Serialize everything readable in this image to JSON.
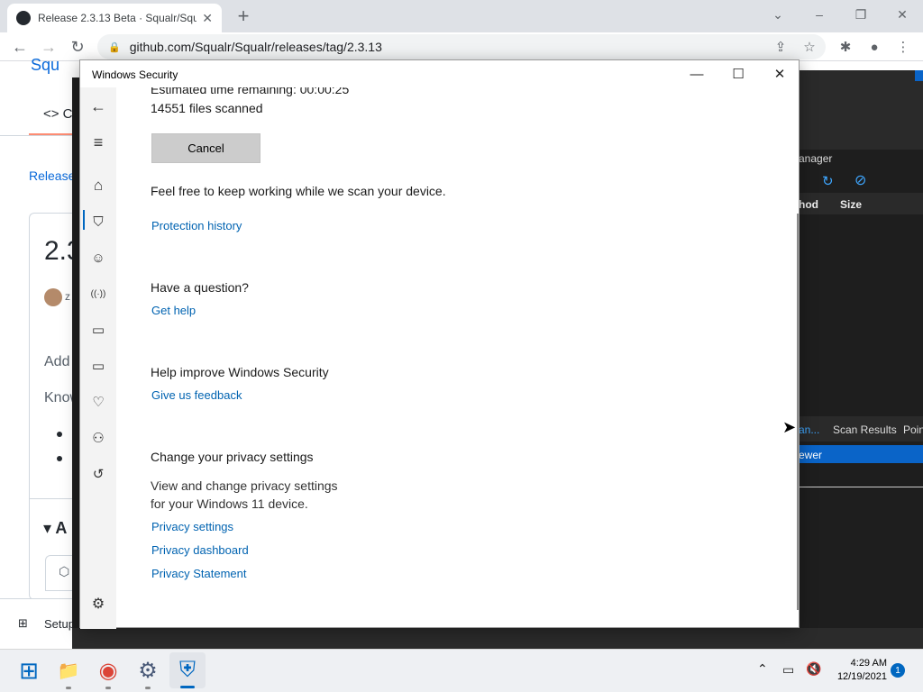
{
  "browser": {
    "tab_title": "Release 2.3.13 Beta · Squalr/Squa",
    "tab_close": "✕",
    "new_tab": "+",
    "url": "github.com/Squalr/Squalr/releases/tag/2.3.13",
    "window_controls": {
      "collapse": "⌄",
      "minimize": "–",
      "restore": "❐",
      "close": "✕"
    },
    "nav": {
      "back": "←",
      "forward": "→",
      "reload": "↻"
    },
    "toolbar_icons": {
      "share": "⇪",
      "star": "☆",
      "extensions": "✱",
      "profile": "●",
      "menu": "⋮"
    }
  },
  "github_bg": {
    "repo": "Squ",
    "code_tab": "<> C",
    "releases_link": "Release",
    "version": "2.3",
    "author": "z",
    "add": "Add",
    "know": "Know",
    "assets": "▾ A",
    "setup": "Setup"
  },
  "darkapp": {
    "manager": "anager",
    "method": "hod",
    "size": "Size",
    "scan_tab": "an...",
    "scan_results": "Scan Results",
    "pointer": "Poin",
    "viewer": "ewer"
  },
  "ws": {
    "title": "Windows Security",
    "controls": {
      "minimize": "—",
      "maximize": "☐",
      "close": "✕"
    },
    "nav_icons": {
      "back": "←",
      "menu": "≡",
      "home": "⌂",
      "shield": "⛉",
      "account": "☺",
      "network": "((·))",
      "app": "▭",
      "device": "▭",
      "health": "♡",
      "family": "⚇",
      "history": "↺",
      "settings": "⚙"
    },
    "estimated_time": "Estimated time remaining: 00:00:25",
    "files_scanned": "14551 files scanned",
    "cancel": "Cancel",
    "keep_working": "Feel free to keep working while we scan your device.",
    "protection_history": "Protection history",
    "question_heading": "Have a question?",
    "get_help": "Get help",
    "improve_heading": "Help improve Windows Security",
    "feedback": "Give us feedback",
    "privacy_heading": "Change your privacy settings",
    "privacy_desc_1": "View and change privacy settings",
    "privacy_desc_2": "for your Windows 11 device.",
    "privacy_settings": "Privacy settings",
    "privacy_dashboard": "Privacy dashboard",
    "privacy_statement": "Privacy Statement"
  },
  "taskbar": {
    "time": "4:29 AM",
    "date": "12/19/2021",
    "notifications": "1",
    "tray_chevron": "⌃",
    "icons": {
      "start": "⊞",
      "explorer": "📁",
      "chrome": "◉",
      "settings": "⚙",
      "defender": "⛨"
    }
  }
}
